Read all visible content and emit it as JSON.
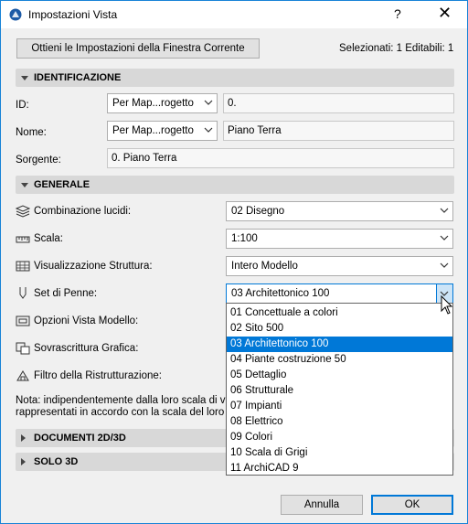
{
  "window": {
    "title": "Impostazioni Vista",
    "help": "?",
    "close": "✕"
  },
  "toolbar": {
    "get_settings_label": "Ottieni le Impostazioni della Finestra Corrente",
    "selection_info": "Selezionati: 1 Editabili: 1"
  },
  "identificazione": {
    "header": "IDENTIFICAZIONE",
    "id_label": "ID:",
    "id_combo": "Per Map...rogetto",
    "id_value": "0.",
    "nome_label": "Nome:",
    "nome_combo": "Per Map...rogetto",
    "nome_value": "Piano Terra",
    "sorgente_label": "Sorgente:",
    "sorgente_value": "0. Piano Terra"
  },
  "generale": {
    "header": "GENERALE",
    "rows": {
      "lucidi_label": "Combinazione lucidi:",
      "lucidi_value": "02 Disegno",
      "scala_label": "Scala:",
      "scala_value": "1:100",
      "struttura_label": "Visualizzazione Struttura:",
      "struttura_value": "Intero Modello",
      "penne_label": "Set di Penne:",
      "penne_value": "03 Architettonico 100",
      "opzioni_label": "Opzioni Vista Modello:",
      "sovrascrittura_label": "Sovrascrittura Grafica:",
      "filtro_label": "Filtro della Ristrutturazione:"
    },
    "note_line1": "Nota: indipendentemente dalla loro scala di v",
    "note_line2": "rappresentati in accordo con la scala del loro"
  },
  "pen_sets": {
    "options": [
      "01 Concettuale a colori",
      "02 Sito 500",
      "03 Architettonico 100",
      "04 Piante costruzione 50",
      "05 Dettaglio",
      "06 Strutturale",
      "07 Impianti",
      "08 Elettrico",
      "09 Colori",
      "10 Scala di Grigi",
      "11 ArchiCAD 9"
    ],
    "selected_index": 2
  },
  "documenti": {
    "header": "DOCUMENTI 2D/3D"
  },
  "solo3d": {
    "header": "SOLO 3D"
  },
  "footer": {
    "cancel_label": "Annulla",
    "ok_label": "OK"
  },
  "colors": {
    "accent": "#0078d7",
    "section_bg": "#d8d8d8",
    "window_border": "#1883d7"
  }
}
